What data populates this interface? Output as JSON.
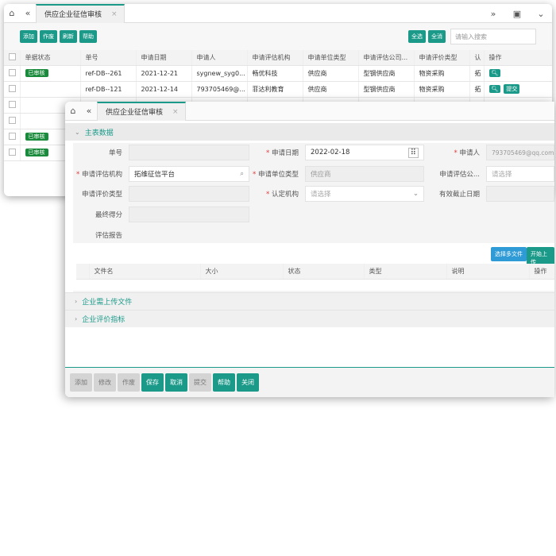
{
  "back": {
    "tab_title": "供应企业征信审核",
    "toolbar": {
      "add": "添加",
      "void": "作废",
      "refresh": "刷新",
      "help": "帮助",
      "select_all": "全选",
      "select_all2": "全消"
    },
    "search_placeholder": "请输入搜索",
    "columns": [
      "单据状态",
      "单号",
      "申请日期",
      "申请人",
      "申请评估机构",
      "申请单位类型",
      "申请评估公司...",
      "申请评价类型",
      "认",
      "操作"
    ],
    "rows": [
      {
        "status": "已审核",
        "no": "ref-DB--261",
        "date": "2021-12-21",
        "applicant": "sygnew_syg0...",
        "agency": "畅优科技",
        "unit_type": "供应商",
        "company": "型钢供应商",
        "eval_type": "物资采购",
        "r": "拓",
        "actions": []
      },
      {
        "status": "",
        "no": "ref-DB--121",
        "date": "2021-12-14",
        "applicant": "793705469@...",
        "agency": "菲达利教育",
        "unit_type": "供应商",
        "company": "型钢供应商",
        "eval_type": "物资采购",
        "r": "拓",
        "actions": [
          "提交"
        ]
      },
      {
        "status": "",
        "no": "",
        "date": "",
        "applicant": "",
        "agency": "",
        "unit_type": "",
        "company": "",
        "eval_type": "",
        "r": "",
        "actions": []
      },
      {
        "status": "",
        "no": "",
        "date": "",
        "applicant": "",
        "agency": "",
        "unit_type": "",
        "company": "",
        "eval_type": "",
        "r": "",
        "actions": []
      },
      {
        "status": "已审核",
        "no": "",
        "date": "",
        "applicant": "",
        "agency": "",
        "unit_type": "",
        "company": "",
        "eval_type": "",
        "r": "",
        "actions": []
      },
      {
        "status": "已审核",
        "no": "",
        "date": "",
        "applicant": "",
        "agency": "",
        "unit_type": "",
        "company": "",
        "eval_type": "",
        "r": "",
        "actions": []
      }
    ]
  },
  "front": {
    "tab_title": "供应企业征信审核",
    "section_main": "主表数据",
    "fields": {
      "doc_no": {
        "label": "单号",
        "value": ""
      },
      "apply_date": {
        "label": "申请日期",
        "value": "2022-02-18"
      },
      "applicant": {
        "label": "申请人",
        "value": "793705469@qq.com"
      },
      "agency": {
        "label": "申请评估机构",
        "value": "拓维征信平台"
      },
      "unit_type": {
        "label": "申请单位类型",
        "value": "供应商"
      },
      "company": {
        "label": "申请评估公...",
        "placeholder": "请选择"
      },
      "eval_type": {
        "label": "申请评价类型",
        "value": ""
      },
      "cert_org": {
        "label": "认定机构",
        "placeholder": "请选择"
      },
      "expiry": {
        "label": "有效截止日期",
        "value": ""
      },
      "score": {
        "label": "最终得分",
        "value": ""
      },
      "report": {
        "label": "评估报告"
      }
    },
    "file_buttons": {
      "select": "选择多文件",
      "upload": "开始上传"
    },
    "file_columns": [
      "文件名",
      "大小",
      "状态",
      "类型",
      "说明",
      "操作"
    ],
    "section_upload": "企业需上传文件",
    "section_index": "企业评价指标",
    "footer": {
      "add": "添加",
      "edit": "修改",
      "void": "作废",
      "save": "保存",
      "cancel": "取消",
      "submit": "提交",
      "help": "帮助",
      "close": "关闭"
    }
  }
}
